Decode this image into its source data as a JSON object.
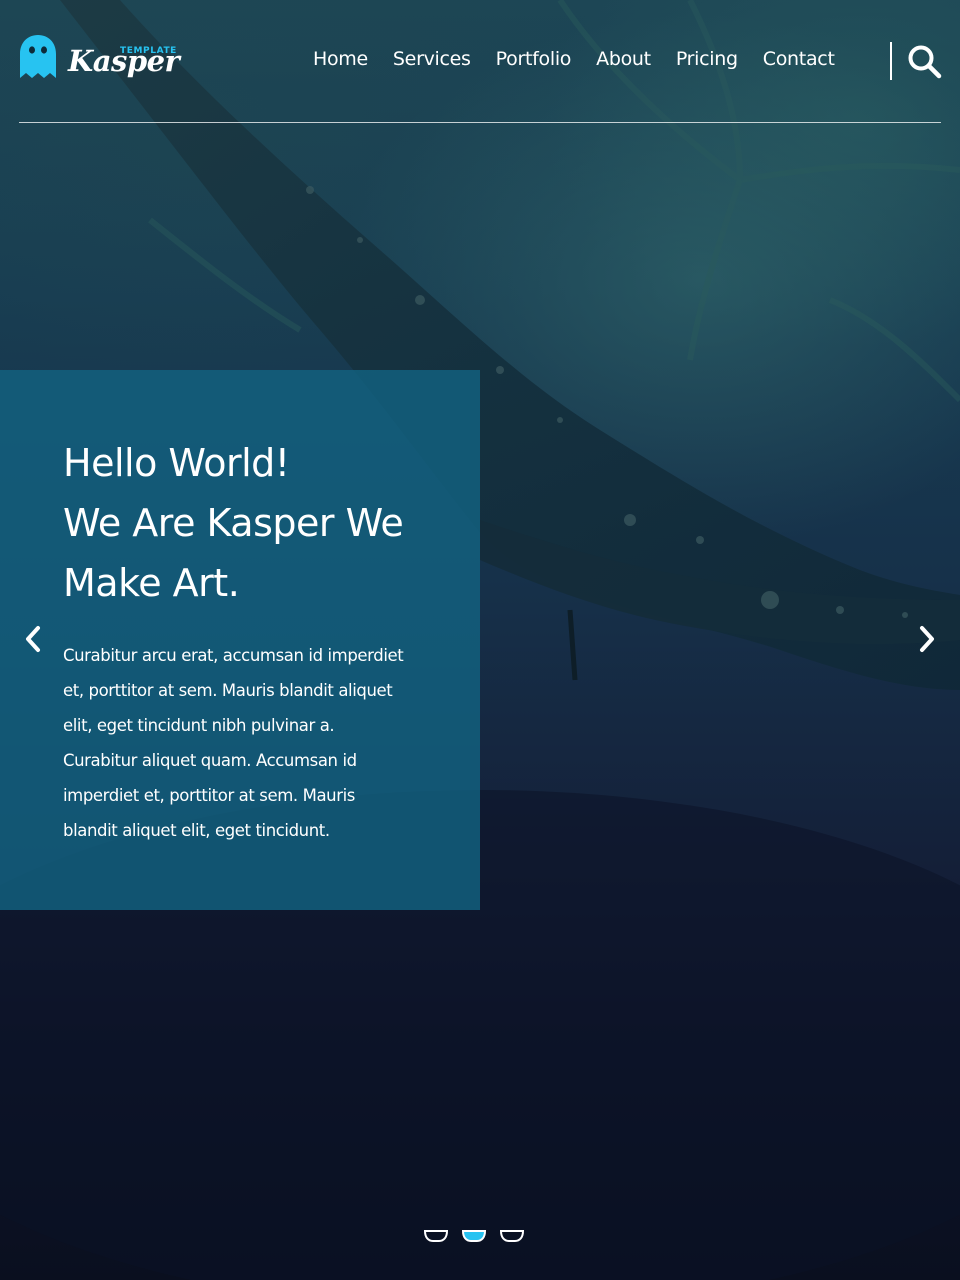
{
  "header": {
    "logo": {
      "small_text": "TEMPLATE",
      "text": "Kasper",
      "accent_color": "#27c3f1"
    },
    "nav": [
      {
        "label": "Home"
      },
      {
        "label": "Services"
      },
      {
        "label": "Portfolio"
      },
      {
        "label": "About"
      },
      {
        "label": "Pricing"
      },
      {
        "label": "Contact"
      }
    ],
    "search_icon": "search-icon"
  },
  "hero": {
    "title_lines": [
      "Hello World!",
      "We Are Kasper We",
      "Make Art."
    ],
    "text_lines": [
      "Curabitur arcu erat, accumsan id imperdiet",
      "et, porttitor at sem. Mauris blandit aliquet",
      "elit, eget tincidunt nibh pulvinar a.",
      "Curabitur aliquet quam. Accumsan id",
      "imperdiet et, porttitor at sem. Mauris",
      "blandit aliquet elit, eget tincidunt."
    ],
    "panel_color": "#126280",
    "prev_icon": "chevron-left-icon",
    "next_icon": "chevron-right-icon"
  },
  "slider": {
    "count": 3,
    "active_index": 1,
    "active_color": "#27c3f1"
  }
}
